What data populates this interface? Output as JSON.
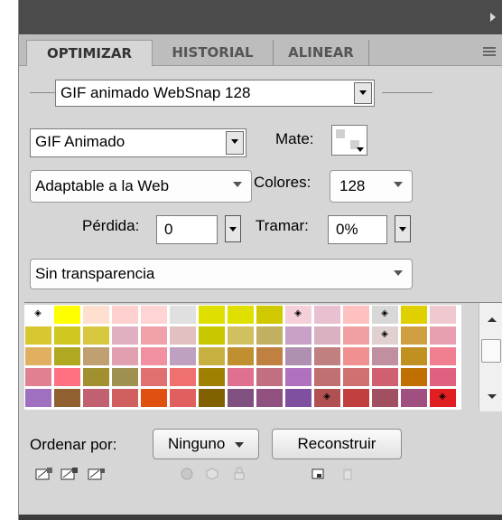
{
  "tabs": [
    {
      "label": "OPTIMIZAR"
    },
    {
      "label": "HISTORIAL"
    },
    {
      "label": "ALINEAR"
    }
  ],
  "preset": {
    "value": "GIF animado WebSnap 128"
  },
  "format": {
    "value": "GIF Animado"
  },
  "matte": {
    "label": "Mate:"
  },
  "palette": {
    "value": "Adaptable a la Web"
  },
  "colors": {
    "label": "Colores:",
    "value": "128"
  },
  "loss": {
    "label": "Pérdida:",
    "value": "0"
  },
  "dither": {
    "label": "Tramar:",
    "value": "0%"
  },
  "transparency": {
    "value": "Sin transparencia"
  },
  "swatches": {
    "rows": [
      [
        "#ffffff",
        "#ffff00",
        "#ffe0d0",
        "#ffd0d0",
        "#ffd4d4",
        "#e0e0e0",
        "#e0e000",
        "#e0e000",
        "#d0c800",
        "#f5d0d8",
        "#e8c0d0",
        "#ffc0c0",
        "#d8d8d8",
        "#e0d000",
        "#f0c8d0"
      ],
      [
        "#d8c830",
        "#d0c820",
        "#d8c840",
        "#e0b0c0",
        "#f0a0a8",
        "#e0c0c0",
        "#c8c800",
        "#d0c060",
        "#c0b060",
        "#c8a0c8",
        "#d8b0c0",
        "#f0a0a0",
        "#e0d0d0",
        "#d0a040",
        "#e8a0b0"
      ],
      [
        "#e0b060",
        "#b0a820",
        "#c0a070",
        "#e0a0b0",
        "#f090a0",
        "#c0a0c0",
        "#c8b040",
        "#c09030",
        "#c08040",
        "#b090b0",
        "#c08080",
        "#f09090",
        "#c090a0",
        "#c09020",
        "#f08090"
      ],
      [
        "#e08090",
        "#ff7080",
        "#a09030",
        "#a09050",
        "#e07070",
        "#f07070",
        "#a08000",
        "#e07090",
        "#c07080",
        "#b070c0",
        "#c07070",
        "#d07070",
        "#d06070",
        "#c07000",
        "#e06080"
      ],
      [
        "#a070c0",
        "#906030",
        "#c06070",
        "#d06060",
        "#e05010",
        "#e06060",
        "#806000",
        "#805080",
        "#905080",
        "#8050a0",
        "#b05050",
        "#c04040",
        "#a05060",
        "#a05080",
        "#e02020"
      ]
    ],
    "marked": [
      "0-0",
      "0-9",
      "0-12",
      "1-12",
      "4-10",
      "4-14"
    ]
  },
  "sort": {
    "label": "Ordenar por:",
    "value": "Ninguno"
  },
  "rebuild": {
    "label": "Reconstruir"
  },
  "icons": [
    "edit-color-icon",
    "lock-color-icon",
    "snap-web-icon",
    "transparent-icon",
    "web-safe-icon",
    "lock-icon",
    "add-swatch-icon",
    "trash-icon"
  ]
}
